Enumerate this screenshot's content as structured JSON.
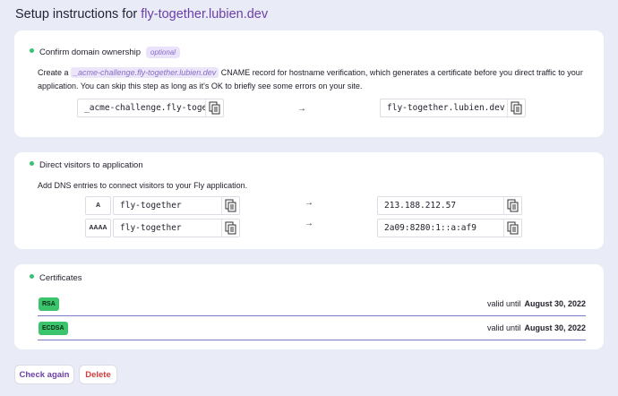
{
  "page": {
    "title_prefix": "Setup instructions for",
    "domain": "fly-together.lubien.dev"
  },
  "ownership": {
    "heading": "Confirm domain ownership",
    "badge": "optional",
    "desc_before": "Create a ",
    "desc_code": "_acme-challenge.fly-together.lubien.dev",
    "desc_after": " CNAME record for hostname verification, which generates a certificate before you direct traffic to your application. You can skip this step as long as it's OK to briefly see some errors on your site.",
    "source_value": "_acme-challenge.fly-together.lubien.dev",
    "target_value": "fly-together.lubien.dev",
    "arrow": "→"
  },
  "direct": {
    "heading": "Direct visitors to application",
    "desc": "Add DNS entries to connect visitors to your Fly application.",
    "records": [
      {
        "type": "A",
        "name": "fly-together",
        "arrow": "→",
        "value": "213.188.212.57"
      },
      {
        "type": "AAAA",
        "name": "fly-together",
        "arrow": "→",
        "value": "2a09:8280:1::a:af9"
      }
    ]
  },
  "certificates": {
    "heading": "Certificates",
    "items": [
      {
        "type": "RSA",
        "valid_label": "valid until",
        "valid_date": "August 30, 2022"
      },
      {
        "type": "ECDSA",
        "valid_label": "valid until",
        "valid_date": "August 30, 2022"
      }
    ]
  },
  "actions": {
    "check_again": "Check again",
    "delete": "Delete"
  },
  "icons": {
    "copy": "copy-icon",
    "status_dot": "status-dot-icon"
  },
  "colors": {
    "accent": "#6b3fa8",
    "success": "#38c172",
    "danger": "#cf3d3d",
    "background": "#e9ebf7"
  }
}
